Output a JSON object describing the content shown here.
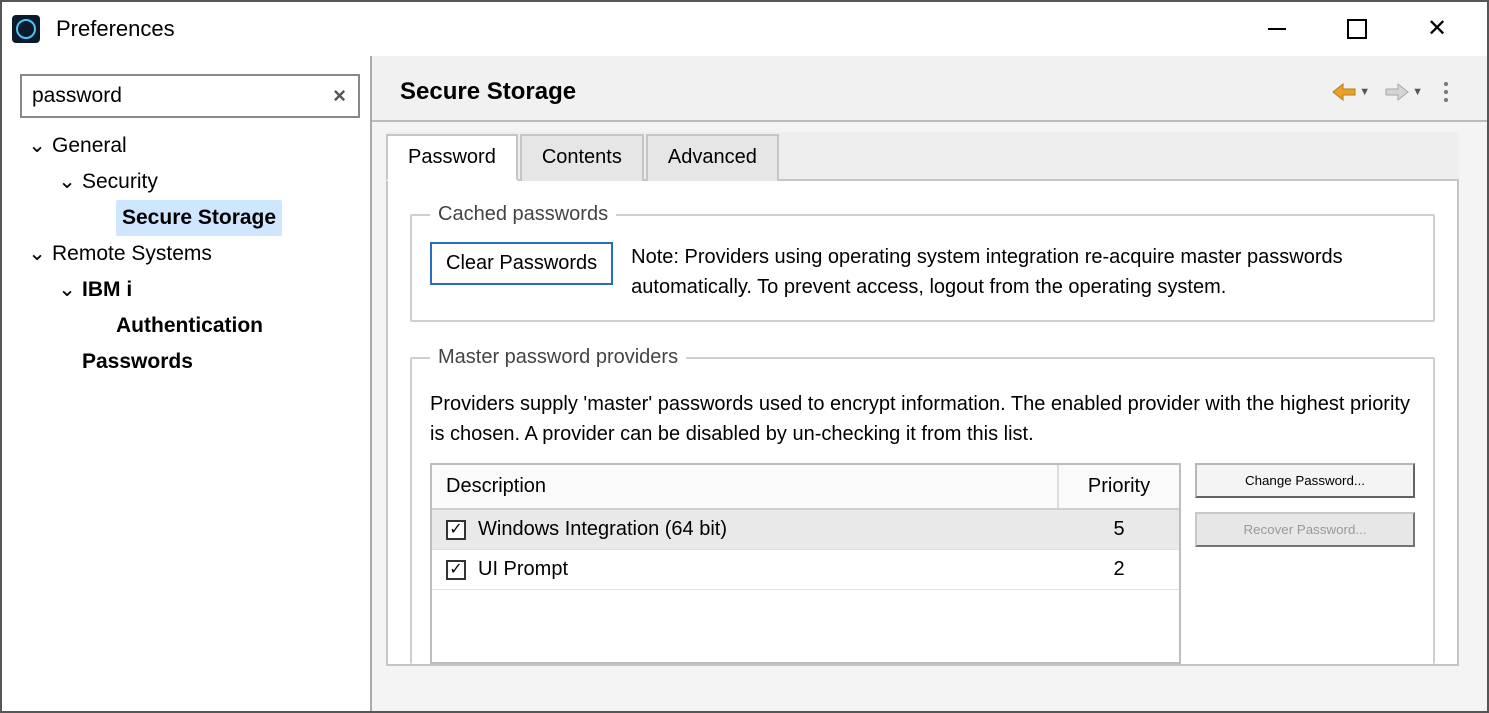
{
  "window": {
    "title": "Preferences"
  },
  "filter": {
    "value": "password"
  },
  "tree": {
    "general": "General",
    "security": "Security",
    "secure_storage": "Secure Storage",
    "remote_systems": "Remote Systems",
    "ibm_i": "IBM i",
    "authentication": "Authentication",
    "passwords": "Passwords"
  },
  "page": {
    "title": "Secure Storage",
    "tabs": {
      "password": "Password",
      "contents": "Contents",
      "advanced": "Advanced"
    },
    "cached": {
      "legend": "Cached passwords",
      "clear_btn": "Clear Passwords",
      "note": "Note: Providers using operating system integration re-acquire master passwords automatically. To prevent access, logout from the operating system."
    },
    "providers": {
      "legend": "Master password providers",
      "desc": "Providers supply 'master' passwords used to encrypt information. The enabled provider with the highest priority is chosen. A provider can be disabled by un-checking it from this list.",
      "col_description": "Description",
      "col_priority": "Priority",
      "rows": [
        {
          "label": "Windows Integration (64 bit)",
          "priority": "5",
          "checked": true,
          "selected": true
        },
        {
          "label": "UI Prompt",
          "priority": "2",
          "checked": true,
          "selected": false
        }
      ],
      "change_btn": "Change Password...",
      "recover_btn": "Recover Password..."
    }
  }
}
